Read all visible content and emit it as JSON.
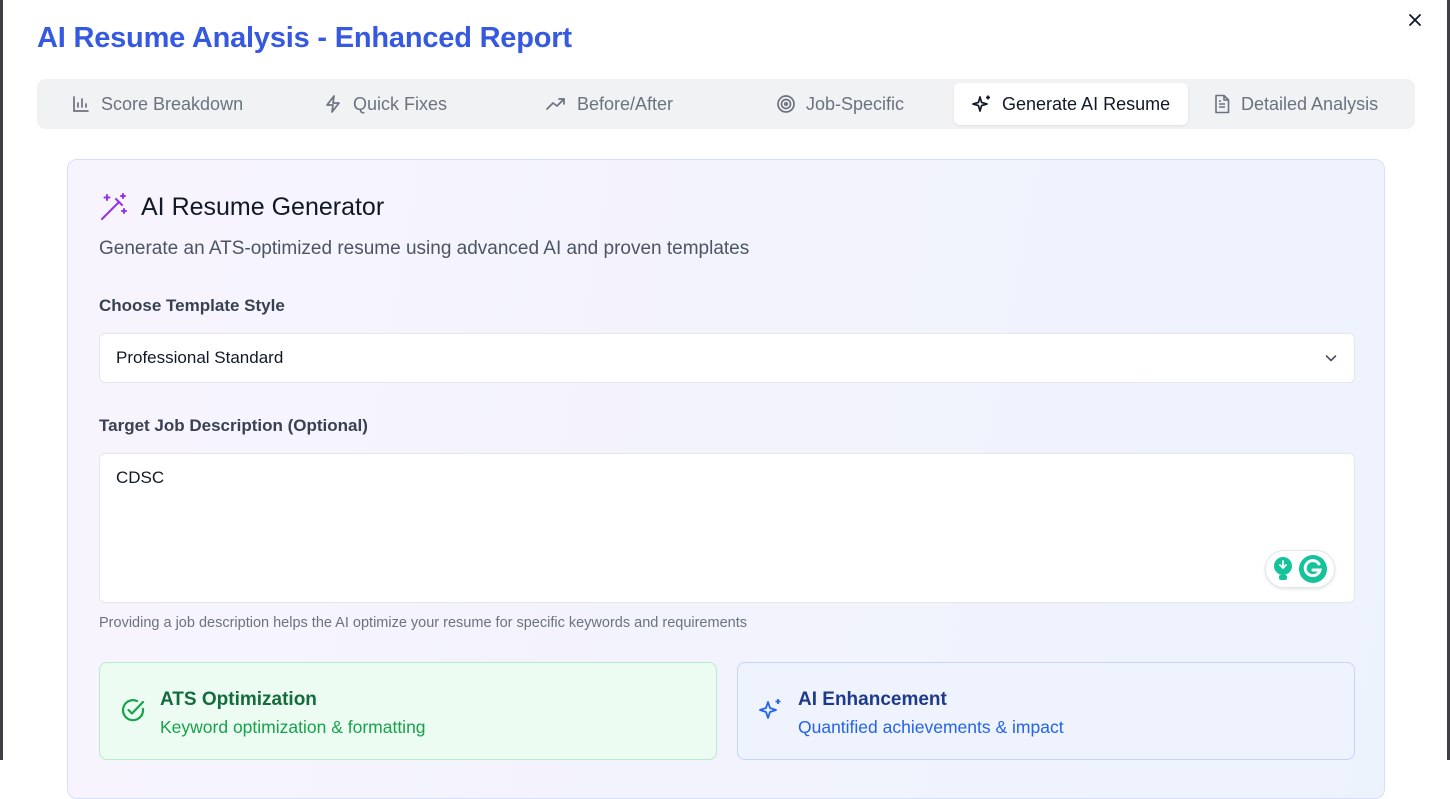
{
  "dialog": {
    "title": "AI Resume Analysis - Enhanced Report",
    "close_icon": "close-icon"
  },
  "tabs": [
    {
      "label": "Score Breakdown",
      "icon": "bar-chart-icon",
      "active": false
    },
    {
      "label": "Quick Fixes",
      "icon": "zap-icon",
      "active": false
    },
    {
      "label": "Before/After",
      "icon": "trending-up-icon",
      "active": false
    },
    {
      "label": "Job-Specific",
      "icon": "target-icon",
      "active": false
    },
    {
      "label": "Generate AI Resume",
      "icon": "sparkles-icon",
      "active": true
    },
    {
      "label": "Detailed Analysis",
      "icon": "file-text-icon",
      "active": false
    }
  ],
  "generator": {
    "title": "AI Resume Generator",
    "subtitle": "Generate an ATS-optimized resume using advanced AI and proven templates",
    "template_label": "Choose Template Style",
    "template_value": "Professional Standard",
    "job_label": "Target Job Description (Optional)",
    "job_value": "CDSC",
    "job_hint": "Providing a job description helps the AI optimize your resume for specific keywords and requirements"
  },
  "features": [
    {
      "title": "ATS Optimization",
      "desc": "Keyword optimization & formatting",
      "color": "#16a34a",
      "icon": "check-circle-icon"
    },
    {
      "title": "AI Enhancement",
      "desc": "Quantified achievements & impact",
      "color": "#2563eb",
      "icon": "sparkles-icon"
    }
  ],
  "colors": {
    "accent": "#3559e0",
    "tab_bg": "#f1f2f4"
  }
}
